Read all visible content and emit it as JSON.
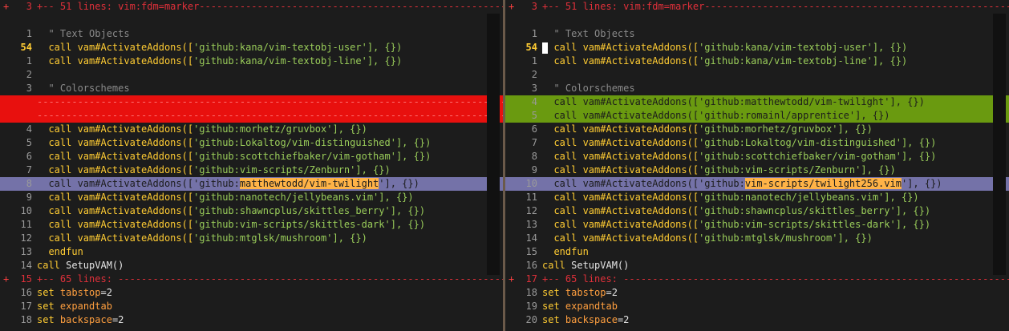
{
  "left": {
    "fold_top": {
      "num": "3",
      "text": "+-- 51 lines: vim:fdm=marker-----------------------------------------------------------------------------"
    },
    "lines": [
      {
        "num": "",
        "type": "blank"
      },
      {
        "num": "1",
        "type": "comment",
        "text": "  \" Text Objects"
      },
      {
        "num": "54",
        "cur": true,
        "type": "addon",
        "pre": "  call vam#ActivateAddons([",
        "repo": "'github:kana/vim-textobj-user'",
        "post": "], {})"
      },
      {
        "num": "1",
        "type": "addon",
        "pre": "  call vam#ActivateAddons([",
        "repo": "'github:kana/vim-textobj-line'",
        "post": "], {})"
      },
      {
        "num": "2",
        "type": "blank"
      },
      {
        "num": "3",
        "type": "comment",
        "text": "  \" Colorschemes"
      },
      {
        "num": "",
        "type": "deleted",
        "text": "----------------------------------------------------------------------------------------------------------------"
      },
      {
        "num": "",
        "type": "deleted",
        "text": "----------------------------------------------------------------------------------------------------------------"
      },
      {
        "num": "4",
        "type": "addon",
        "pre": "  call vam#ActivateAddons([",
        "repo": "'github:morhetz/gruvbox'",
        "post": "], {})"
      },
      {
        "num": "5",
        "type": "addon",
        "pre": "  call vam#ActivateAddons([",
        "repo": "'github:Lokaltog/vim-distinguished'",
        "post": "], {})"
      },
      {
        "num": "6",
        "type": "addon",
        "pre": "  call vam#ActivateAddons([",
        "repo": "'github:scottchiefbaker/vim-gotham'",
        "post": "], {})"
      },
      {
        "num": "7",
        "type": "addon",
        "pre": "  call vam#ActivateAddons([",
        "repo": "'github:vim-scripts/Zenburn'",
        "post": "], {})"
      },
      {
        "num": "8",
        "type": "changed",
        "pre": "  call vam#ActivateAddons(['github:",
        "hl": "matthewtodd/vim-twilight",
        "post": "'], {})"
      },
      {
        "num": "9",
        "type": "addon",
        "pre": "  call vam#ActivateAddons([",
        "repo": "'github:nanotech/jellybeans.vim'",
        "post": "], {})"
      },
      {
        "num": "10",
        "type": "addon",
        "pre": "  call vam#ActivateAddons([",
        "repo": "'github:shawncplus/skittles_berry'",
        "post": "], {})"
      },
      {
        "num": "11",
        "type": "addon",
        "pre": "  call vam#ActivateAddons([",
        "repo": "'github:vim-scripts/skittles-dark'",
        "post": "], {})"
      },
      {
        "num": "12",
        "type": "addon",
        "pre": "  call vam#ActivateAddons([",
        "repo": "'github:mtglsk/mushroom'",
        "post": "], {})"
      },
      {
        "num": "13",
        "type": "plain",
        "kw": "  endfun",
        "rest": ""
      },
      {
        "num": "14",
        "type": "plain",
        "kw": "call",
        "rest": " SetupVAM()"
      },
      {
        "num": "15",
        "type": "fold",
        "text": "+-- 65 lines: -----------------------------------------------------------------------------------------"
      },
      {
        "num": "16",
        "type": "set",
        "opt": "tabstop",
        "val": "=2"
      },
      {
        "num": "17",
        "type": "set",
        "opt": "expandtab",
        "val": ""
      },
      {
        "num": "18",
        "type": "set",
        "opt": "backspace",
        "val": "=2"
      }
    ]
  },
  "right": {
    "fold_top": {
      "num": "3",
      "text": "+-- 51 lines: vim:fdm=marker-----------------------------------------------------------------------------"
    },
    "lines": [
      {
        "num": "",
        "type": "blank"
      },
      {
        "num": "1",
        "type": "comment",
        "text": "  \" Text Objects"
      },
      {
        "num": "54",
        "cur": true,
        "cursor": true,
        "type": "addon",
        "pre": "  call vam#ActivateAddons([",
        "repo": "'github:kana/vim-textobj-user'",
        "post": "], {})"
      },
      {
        "num": "1",
        "type": "addon",
        "pre": "  call vam#ActivateAddons([",
        "repo": "'github:kana/vim-textobj-line'",
        "post": "], {})"
      },
      {
        "num": "2",
        "type": "blank"
      },
      {
        "num": "3",
        "type": "comment",
        "text": "  \" Colorschemes"
      },
      {
        "num": "4",
        "type": "added",
        "text": "  call vam#ActivateAddons(['github:matthewtodd/vim-twilight'], {})"
      },
      {
        "num": "5",
        "type": "added",
        "text": "  call vam#ActivateAddons(['github:romainl/apprentice'], {})"
      },
      {
        "num": "6",
        "type": "addon",
        "pre": "  call vam#ActivateAddons([",
        "repo": "'github:morhetz/gruvbox'",
        "post": "], {})"
      },
      {
        "num": "7",
        "type": "addon",
        "pre": "  call vam#ActivateAddons([",
        "repo": "'github:Lokaltog/vim-distinguished'",
        "post": "], {})"
      },
      {
        "num": "8",
        "type": "addon",
        "pre": "  call vam#ActivateAddons([",
        "repo": "'github:scottchiefbaker/vim-gotham'",
        "post": "], {})"
      },
      {
        "num": "9",
        "type": "addon",
        "pre": "  call vam#ActivateAddons([",
        "repo": "'github:vim-scripts/Zenburn'",
        "post": "], {})"
      },
      {
        "num": "10",
        "type": "changed",
        "pre": "  call vam#ActivateAddons(['github:",
        "hl": "vim-scripts/twilight256.vim",
        "post": "'], {})"
      },
      {
        "num": "11",
        "type": "addon",
        "pre": "  call vam#ActivateAddons([",
        "repo": "'github:nanotech/jellybeans.vim'",
        "post": "], {})"
      },
      {
        "num": "12",
        "type": "addon",
        "pre": "  call vam#ActivateAddons([",
        "repo": "'github:shawncplus/skittles_berry'",
        "post": "], {})"
      },
      {
        "num": "13",
        "type": "addon",
        "pre": "  call vam#ActivateAddons([",
        "repo": "'github:vim-scripts/skittles-dark'",
        "post": "], {})"
      },
      {
        "num": "14",
        "type": "addon",
        "pre": "  call vam#ActivateAddons([",
        "repo": "'github:mtglsk/mushroom'",
        "post": "], {})"
      },
      {
        "num": "15",
        "type": "plain",
        "kw": "  endfun",
        "rest": ""
      },
      {
        "num": "16",
        "type": "plain",
        "kw": "call",
        "rest": " SetupVAM()"
      },
      {
        "num": "17",
        "type": "fold",
        "text": "+-- 65 lines: -----------------------------------------------------------------------------------------"
      },
      {
        "num": "18",
        "type": "set",
        "opt": "tabstop",
        "val": "=2"
      },
      {
        "num": "19",
        "type": "set",
        "opt": "expandtab",
        "val": ""
      },
      {
        "num": "20",
        "type": "set",
        "opt": "backspace",
        "val": "=2"
      }
    ]
  },
  "keywords": {
    "set": "set",
    "sign_fold": "+"
  },
  "colors": {
    "deleted": "#e8100e",
    "added": "#6a9a10",
    "changed": "#7472a8",
    "changed_text": "#ffb347",
    "fold": "#e0303a",
    "line_number_current": "#ffcc33"
  }
}
